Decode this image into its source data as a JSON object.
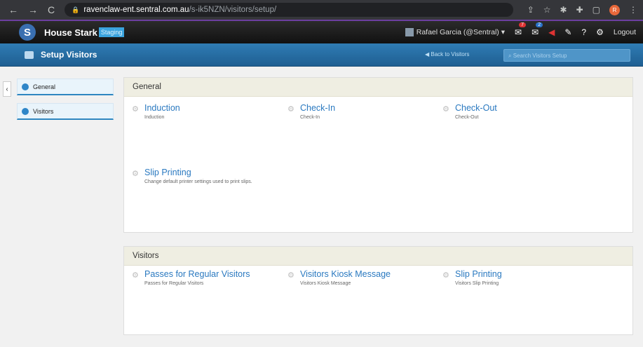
{
  "browser": {
    "url_host": "ravenclaw-ent.sentral.com.au",
    "url_path": "/s-ik5NZN/visitors/setup/",
    "profile_initial": "R"
  },
  "app": {
    "school_name": "House Stark",
    "environment_badge": "Staging",
    "user_label": "Rafael Garcia (@Sentral)",
    "messages_count": "7",
    "notifications_count": "2",
    "logout_label": "Logout"
  },
  "titlebar": {
    "title": "Setup Visitors",
    "back_label": "Back to Visitors",
    "search_placeholder": "Search Visitors Setup"
  },
  "sidebar": {
    "items": [
      {
        "label": "General"
      },
      {
        "label": "Visitors"
      }
    ]
  },
  "sections": [
    {
      "heading": "General",
      "tiles": [
        {
          "title": "Induction",
          "desc": "Induction"
        },
        {
          "title": "Check-In",
          "desc": "Check-In"
        },
        {
          "title": "Check-Out",
          "desc": "Check-Out"
        },
        {
          "title": "Slip Printing",
          "desc": "Change default printer settings used to print slips."
        }
      ]
    },
    {
      "heading": "Visitors",
      "tiles": [
        {
          "title": "Passes for Regular Visitors",
          "desc": "Passes for Regular Visitors"
        },
        {
          "title": "Visitors Kiosk Message",
          "desc": "Visitors Kiosk Message"
        },
        {
          "title": "Slip Printing",
          "desc": "Visitors Slip Printing"
        }
      ]
    }
  ]
}
